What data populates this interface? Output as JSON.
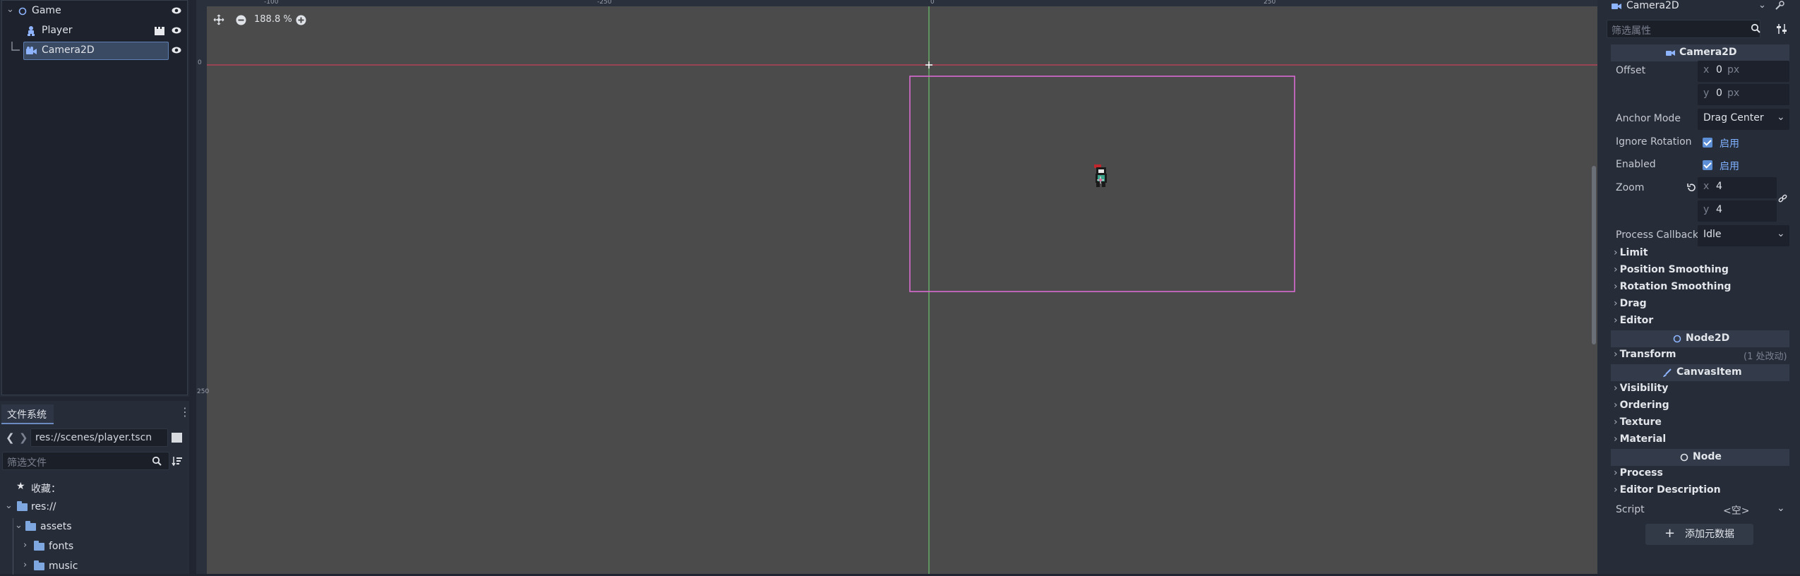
{
  "scene_tree": {
    "nodes": [
      {
        "name": "Game"
      },
      {
        "name": "Player"
      },
      {
        "name": "Camera2D"
      }
    ]
  },
  "filesystem": {
    "tab_label": "文件系统",
    "path": "res://scenes/player.tscn",
    "filter_placeholder": "筛选文件",
    "favorites_label": "收藏：",
    "root": "res://",
    "items": [
      "assets",
      "fonts",
      "music"
    ]
  },
  "viewport": {
    "zoom_label": "188.8 %",
    "ruler_top": [
      "-100",
      "-250",
      "0",
      "250"
    ],
    "ruler_left": [
      "0",
      "250"
    ]
  },
  "inspector": {
    "node_name": "Camera2D",
    "filter_placeholder": "筛选属性",
    "class_header": "Camera2D",
    "offset_label": "Offset",
    "offset_x_axis": "x",
    "offset_x": "0",
    "offset_x_unit": "px",
    "offset_y_axis": "y",
    "offset_y": "0",
    "offset_y_unit": "px",
    "anchor_mode_label": "Anchor Mode",
    "anchor_mode_value": "Drag Center",
    "ignore_rotation_label": "Ignore Rotation",
    "ignore_rotation_value": "启用",
    "enabled_label": "Enabled",
    "enabled_value": "启用",
    "zoom_label": "Zoom",
    "zoom_x_axis": "x",
    "zoom_x": "4",
    "zoom_y_axis": "y",
    "zoom_y": "4",
    "process_callback_label": "Process Callback",
    "process_callback_value": "Idle",
    "camera_groups": [
      "Limit",
      "Position Smoothing",
      "Rotation Smoothing",
      "Drag",
      "Editor"
    ],
    "node2d_header": "Node2D",
    "transform_label": "Transform",
    "transform_changes": "(1 处改动)",
    "canvasitem_header": "CanvasItem",
    "canvas_groups": [
      "Visibility",
      "Ordering",
      "Texture",
      "Material"
    ],
    "node_header": "Node",
    "node_groups": [
      "Process",
      "Editor Description"
    ],
    "script_label": "Script",
    "script_value": "<空>",
    "add_metadata_label": "添加元数据"
  },
  "colors": {
    "viewport_bg": "#4b4b4b",
    "camera_frame": "#d86ad0",
    "x_axis": "#c8405a",
    "y_axis": "#6bc26b",
    "accent": "#7fb0ff"
  }
}
